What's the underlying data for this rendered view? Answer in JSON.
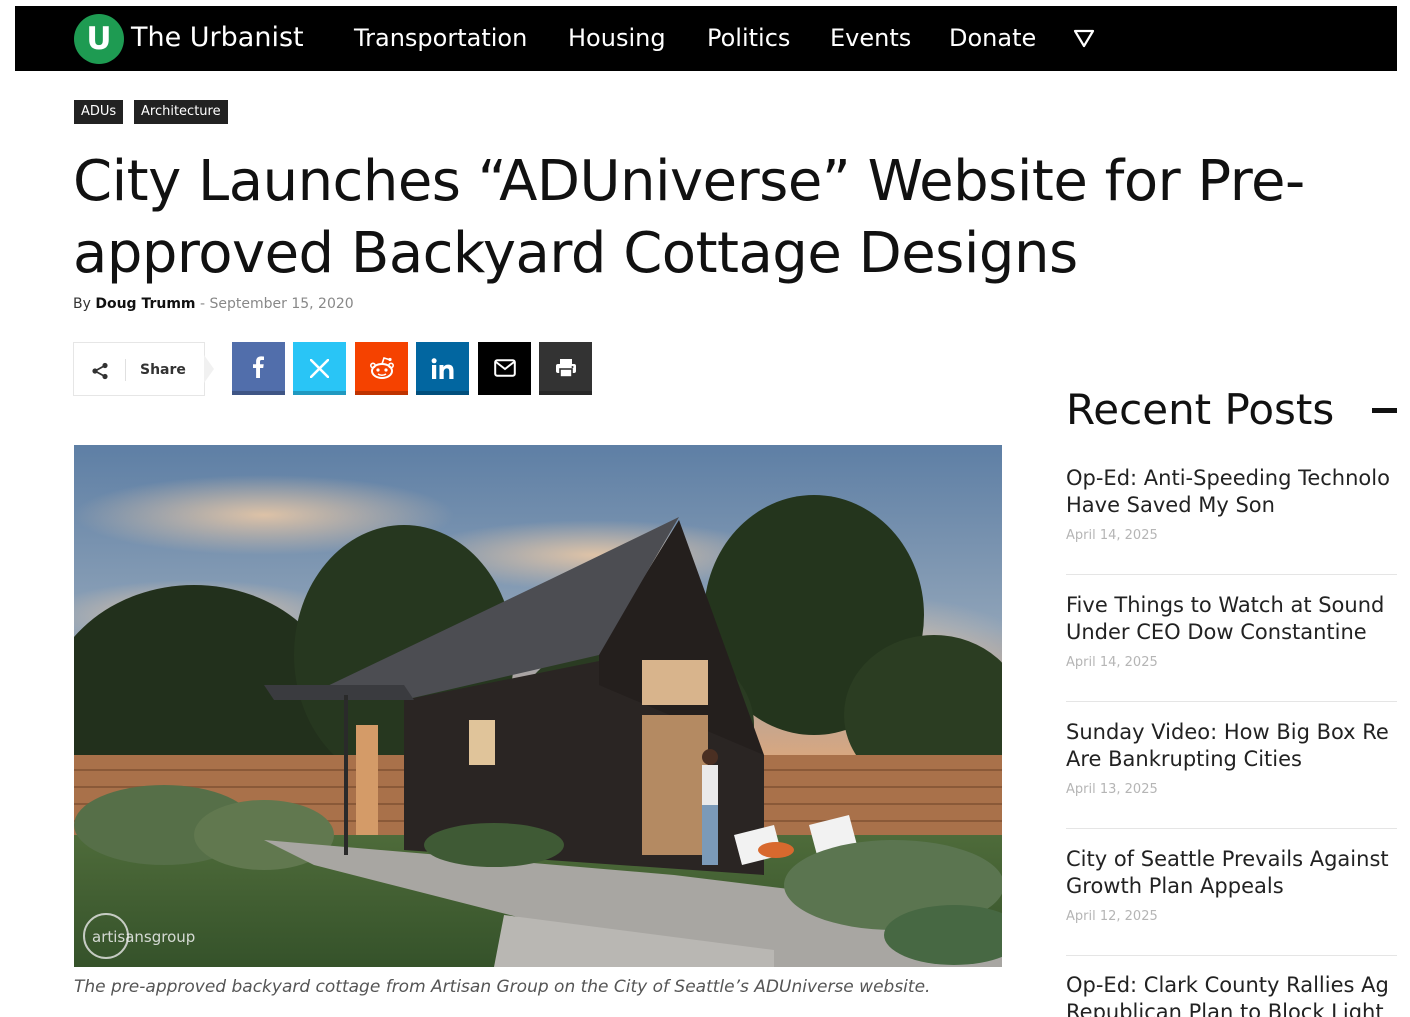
{
  "nav": {
    "logo_letter": "U",
    "brand": "The Urbanist",
    "items": [
      {
        "label": "Transportation"
      },
      {
        "label": "Housing"
      },
      {
        "label": "Politics"
      },
      {
        "label": "Events"
      },
      {
        "label": "Donate"
      }
    ],
    "more_icon": "triangle-down-icon"
  },
  "tags": [
    "ADUs",
    "Architecture"
  ],
  "article": {
    "title": "City Launches “ADUniverse” Website for Pre-approved Backyard Cottage Designs",
    "by": "By",
    "author": "Doug Trumm",
    "separator": "-",
    "date": "September 15, 2020",
    "caption": "The pre-approved backyard cottage from Artisan Group on the City of Seattle’s ADUniverse website.",
    "image_watermark": "artisansgroup"
  },
  "share": {
    "label": "Share",
    "buttons": [
      {
        "network": "facebook",
        "icon": "facebook-icon",
        "color": "#516eab",
        "glyph": "f"
      },
      {
        "network": "x",
        "icon": "x-icon",
        "color": "#29c5f6",
        "glyph": "X"
      },
      {
        "network": "reddit",
        "icon": "reddit-icon",
        "color": "#f54200",
        "glyph": ""
      },
      {
        "network": "linkedin",
        "icon": "linkedin-icon",
        "color": "#0266a0",
        "glyph": "in"
      },
      {
        "network": "email",
        "icon": "email-icon",
        "color": "#000000",
        "glyph": ""
      },
      {
        "network": "print",
        "icon": "print-icon",
        "color": "#333333",
        "glyph": ""
      }
    ]
  },
  "sidebar": {
    "title": "Recent Posts",
    "posts": [
      {
        "title_line1": "Op-Ed: Anti-Speeding Technolo",
        "title_line2": "Have Saved My Son",
        "date": "April 14, 2025"
      },
      {
        "title_line1": "Five Things to Watch at Sound",
        "title_line2": "Under CEO Dow Constantine",
        "date": "April 14, 2025"
      },
      {
        "title_line1": "Sunday Video: How Big Box Re",
        "title_line2": "Are Bankrupting Cities",
        "date": "April 13, 2025"
      },
      {
        "title_line1": "City of Seattle Prevails Against",
        "title_line2": "Growth Plan Appeals",
        "date": "April 12, 2025"
      },
      {
        "title_line1": "Op-Ed: Clark County Rallies Ag",
        "title_line2": "Republican Plan to Block Light",
        "date": ""
      }
    ]
  },
  "colors": {
    "nav_bg": "#000000",
    "logo_green": "#1e9b52",
    "tag_bg": "#222222"
  }
}
